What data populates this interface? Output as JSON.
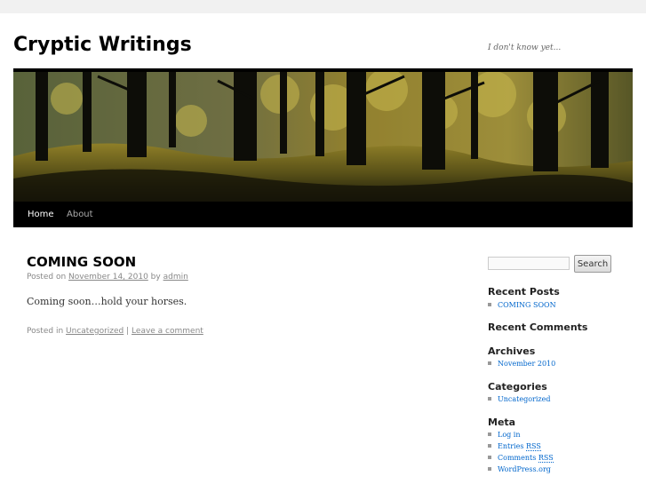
{
  "site": {
    "title": "Cryptic Writings",
    "description": "I don't know yet..."
  },
  "nav": {
    "items": [
      {
        "label": "Home",
        "current": true
      },
      {
        "label": "About",
        "current": false
      }
    ]
  },
  "post": {
    "title": "COMING SOON",
    "meta": {
      "posted_on": "Posted on",
      "date": "November 14, 2010",
      "by": "by",
      "author": "admin"
    },
    "content": "Coming soon…hold your horses.",
    "utility": {
      "posted_in": "Posted in",
      "category": "Uncategorized",
      "separator": "|",
      "comment_link": "Leave a comment"
    }
  },
  "sidebar": {
    "search": {
      "placeholder": "",
      "button_label": "Search"
    },
    "recent_posts": {
      "title": "Recent Posts",
      "items": [
        "COMING SOON"
      ]
    },
    "recent_comments": {
      "title": "Recent Comments"
    },
    "archives": {
      "title": "Archives",
      "items": [
        "November 2010"
      ]
    },
    "categories": {
      "title": "Categories",
      "items": [
        "Uncategorized"
      ]
    },
    "meta": {
      "title": "Meta",
      "items": {
        "login": "Log in",
        "entries": "Entries",
        "comments": "Comments",
        "rss": "RSS",
        "wordpress": "WordPress.org"
      }
    }
  },
  "colors": {
    "link": "#0066cc",
    "nav_background": "#000000",
    "page_background": "#f1f1f1"
  }
}
